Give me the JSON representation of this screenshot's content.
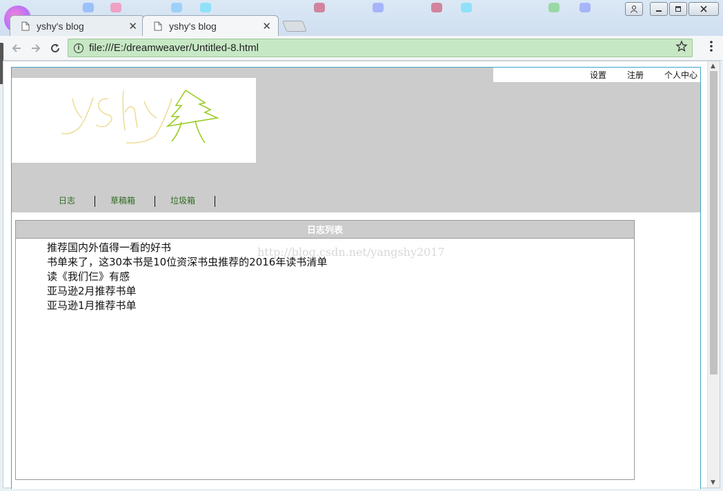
{
  "browser": {
    "tabs": [
      {
        "title": "yshy's blog",
        "active": false
      },
      {
        "title": "yshy's blog",
        "active": true
      }
    ],
    "url": "file:///E:/dreamweaver/Untitled-8.html",
    "tab_close_glyph": "✕"
  },
  "page": {
    "top_links": [
      "设置",
      "注册",
      "个人中心"
    ],
    "nav": [
      "日志",
      "草稿箱",
      "垃圾箱"
    ],
    "list_title": "日志列表",
    "articles": [
      "推荐国内外值得一看的好书",
      "书单来了，这30本书是10位资深书虫推荐的2016年读书清单",
      "读《我们仨》有感",
      "亚马逊2月推荐书单",
      "亚马逊1月推荐书单"
    ],
    "watermark": "http://blog.csdn.net/yangshy2017"
  },
  "colors": {
    "header_gray": "#cccccc",
    "nav_link": "#2f6b22",
    "omnibox_green": "#c7e8c4",
    "page_border": "#3fa3c8"
  }
}
